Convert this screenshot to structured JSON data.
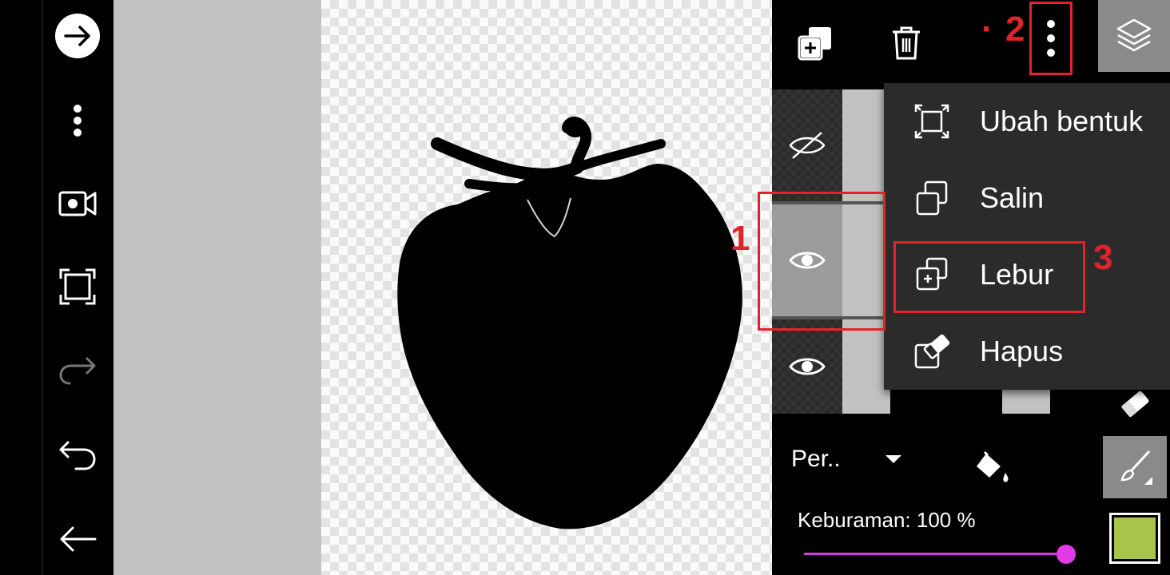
{
  "layers_menu": {
    "items": [
      {
        "label": "Ubah bentuk",
        "icon": "transform-icon"
      },
      {
        "label": "Salin",
        "icon": "copy-icon"
      },
      {
        "label": "Lebur",
        "icon": "merge-icon"
      },
      {
        "label": "Hapus",
        "icon": "eraser-icon"
      }
    ]
  },
  "layer_panel": {
    "blend_mode": "Per..",
    "opacity_label": "Keburaman: 100 %",
    "opacity_value": 1.0
  },
  "annotations": {
    "step1": "1",
    "step2": "2",
    "step2_dot": "·",
    "step3": "3"
  },
  "colors": {
    "accent": "#e13ae6",
    "annotation_red": "#e0242a",
    "current_color": "#a8c44a",
    "canvas_bg": "#c2c2c2"
  }
}
